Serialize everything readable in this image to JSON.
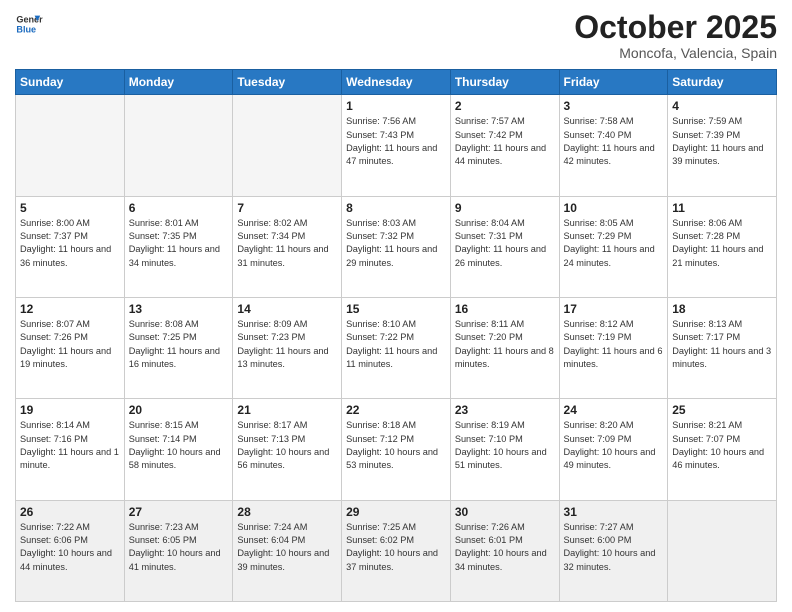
{
  "header": {
    "logo_general": "General",
    "logo_blue": "Blue",
    "month": "October 2025",
    "location": "Moncofa, Valencia, Spain"
  },
  "weekdays": [
    "Sunday",
    "Monday",
    "Tuesday",
    "Wednesday",
    "Thursday",
    "Friday",
    "Saturday"
  ],
  "weeks": [
    [
      {
        "day": "",
        "info": ""
      },
      {
        "day": "",
        "info": ""
      },
      {
        "day": "",
        "info": ""
      },
      {
        "day": "1",
        "info": "Sunrise: 7:56 AM\nSunset: 7:43 PM\nDaylight: 11 hours and 47 minutes."
      },
      {
        "day": "2",
        "info": "Sunrise: 7:57 AM\nSunset: 7:42 PM\nDaylight: 11 hours and 44 minutes."
      },
      {
        "day": "3",
        "info": "Sunrise: 7:58 AM\nSunset: 7:40 PM\nDaylight: 11 hours and 42 minutes."
      },
      {
        "day": "4",
        "info": "Sunrise: 7:59 AM\nSunset: 7:39 PM\nDaylight: 11 hours and 39 minutes."
      }
    ],
    [
      {
        "day": "5",
        "info": "Sunrise: 8:00 AM\nSunset: 7:37 PM\nDaylight: 11 hours and 36 minutes."
      },
      {
        "day": "6",
        "info": "Sunrise: 8:01 AM\nSunset: 7:35 PM\nDaylight: 11 hours and 34 minutes."
      },
      {
        "day": "7",
        "info": "Sunrise: 8:02 AM\nSunset: 7:34 PM\nDaylight: 11 hours and 31 minutes."
      },
      {
        "day": "8",
        "info": "Sunrise: 8:03 AM\nSunset: 7:32 PM\nDaylight: 11 hours and 29 minutes."
      },
      {
        "day": "9",
        "info": "Sunrise: 8:04 AM\nSunset: 7:31 PM\nDaylight: 11 hours and 26 minutes."
      },
      {
        "day": "10",
        "info": "Sunrise: 8:05 AM\nSunset: 7:29 PM\nDaylight: 11 hours and 24 minutes."
      },
      {
        "day": "11",
        "info": "Sunrise: 8:06 AM\nSunset: 7:28 PM\nDaylight: 11 hours and 21 minutes."
      }
    ],
    [
      {
        "day": "12",
        "info": "Sunrise: 8:07 AM\nSunset: 7:26 PM\nDaylight: 11 hours and 19 minutes."
      },
      {
        "day": "13",
        "info": "Sunrise: 8:08 AM\nSunset: 7:25 PM\nDaylight: 11 hours and 16 minutes."
      },
      {
        "day": "14",
        "info": "Sunrise: 8:09 AM\nSunset: 7:23 PM\nDaylight: 11 hours and 13 minutes."
      },
      {
        "day": "15",
        "info": "Sunrise: 8:10 AM\nSunset: 7:22 PM\nDaylight: 11 hours and 11 minutes."
      },
      {
        "day": "16",
        "info": "Sunrise: 8:11 AM\nSunset: 7:20 PM\nDaylight: 11 hours and 8 minutes."
      },
      {
        "day": "17",
        "info": "Sunrise: 8:12 AM\nSunset: 7:19 PM\nDaylight: 11 hours and 6 minutes."
      },
      {
        "day": "18",
        "info": "Sunrise: 8:13 AM\nSunset: 7:17 PM\nDaylight: 11 hours and 3 minutes."
      }
    ],
    [
      {
        "day": "19",
        "info": "Sunrise: 8:14 AM\nSunset: 7:16 PM\nDaylight: 11 hours and 1 minute."
      },
      {
        "day": "20",
        "info": "Sunrise: 8:15 AM\nSunset: 7:14 PM\nDaylight: 10 hours and 58 minutes."
      },
      {
        "day": "21",
        "info": "Sunrise: 8:17 AM\nSunset: 7:13 PM\nDaylight: 10 hours and 56 minutes."
      },
      {
        "day": "22",
        "info": "Sunrise: 8:18 AM\nSunset: 7:12 PM\nDaylight: 10 hours and 53 minutes."
      },
      {
        "day": "23",
        "info": "Sunrise: 8:19 AM\nSunset: 7:10 PM\nDaylight: 10 hours and 51 minutes."
      },
      {
        "day": "24",
        "info": "Sunrise: 8:20 AM\nSunset: 7:09 PM\nDaylight: 10 hours and 49 minutes."
      },
      {
        "day": "25",
        "info": "Sunrise: 8:21 AM\nSunset: 7:07 PM\nDaylight: 10 hours and 46 minutes."
      }
    ],
    [
      {
        "day": "26",
        "info": "Sunrise: 7:22 AM\nSunset: 6:06 PM\nDaylight: 10 hours and 44 minutes."
      },
      {
        "day": "27",
        "info": "Sunrise: 7:23 AM\nSunset: 6:05 PM\nDaylight: 10 hours and 41 minutes."
      },
      {
        "day": "28",
        "info": "Sunrise: 7:24 AM\nSunset: 6:04 PM\nDaylight: 10 hours and 39 minutes."
      },
      {
        "day": "29",
        "info": "Sunrise: 7:25 AM\nSunset: 6:02 PM\nDaylight: 10 hours and 37 minutes."
      },
      {
        "day": "30",
        "info": "Sunrise: 7:26 AM\nSunset: 6:01 PM\nDaylight: 10 hours and 34 minutes."
      },
      {
        "day": "31",
        "info": "Sunrise: 7:27 AM\nSunset: 6:00 PM\nDaylight: 10 hours and 32 minutes."
      },
      {
        "day": "",
        "info": ""
      }
    ]
  ]
}
